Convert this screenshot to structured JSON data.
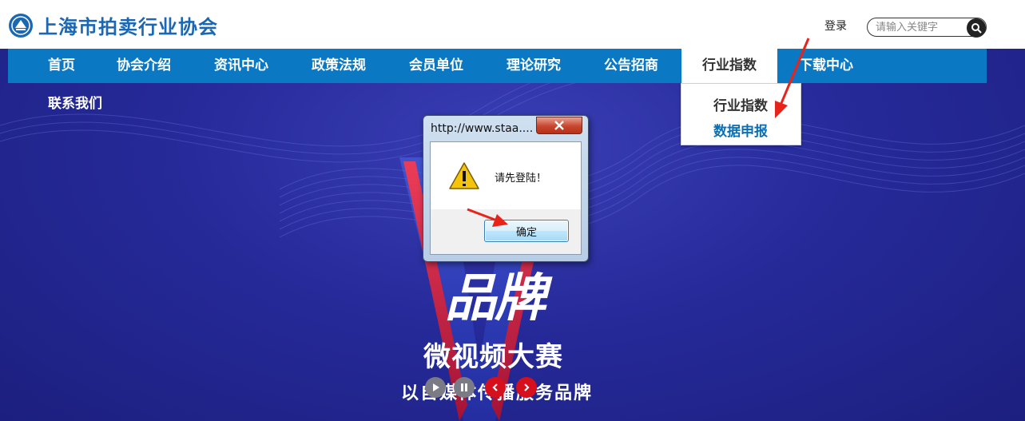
{
  "header": {
    "logo_text": "上海市拍卖行业协会",
    "login_label": "登录",
    "search_placeholder": "请输入关键字"
  },
  "nav": {
    "items": [
      {
        "label": "首页"
      },
      {
        "label": "协会介绍"
      },
      {
        "label": "资讯中心"
      },
      {
        "label": "政策法规"
      },
      {
        "label": "会员单位"
      },
      {
        "label": "理论研究"
      },
      {
        "label": "公告招商"
      },
      {
        "label": "行业指数",
        "active": true
      },
      {
        "label": "下载中心"
      },
      {
        "label": "联系我们"
      }
    ],
    "dropdown": [
      "行业指数",
      "数据申报"
    ]
  },
  "banner": {
    "headline": "品牌",
    "subheadline": "微视频大赛",
    "tagline": "以自媒体传播服务品牌"
  },
  "dialog": {
    "title": "http://www.staa....",
    "message": "请先登陆！",
    "ok_label": "确定"
  },
  "colors": {
    "nav_blue": "#0a78c2",
    "annotation_red": "#e8231c",
    "slider_red": "#d60f1c"
  }
}
